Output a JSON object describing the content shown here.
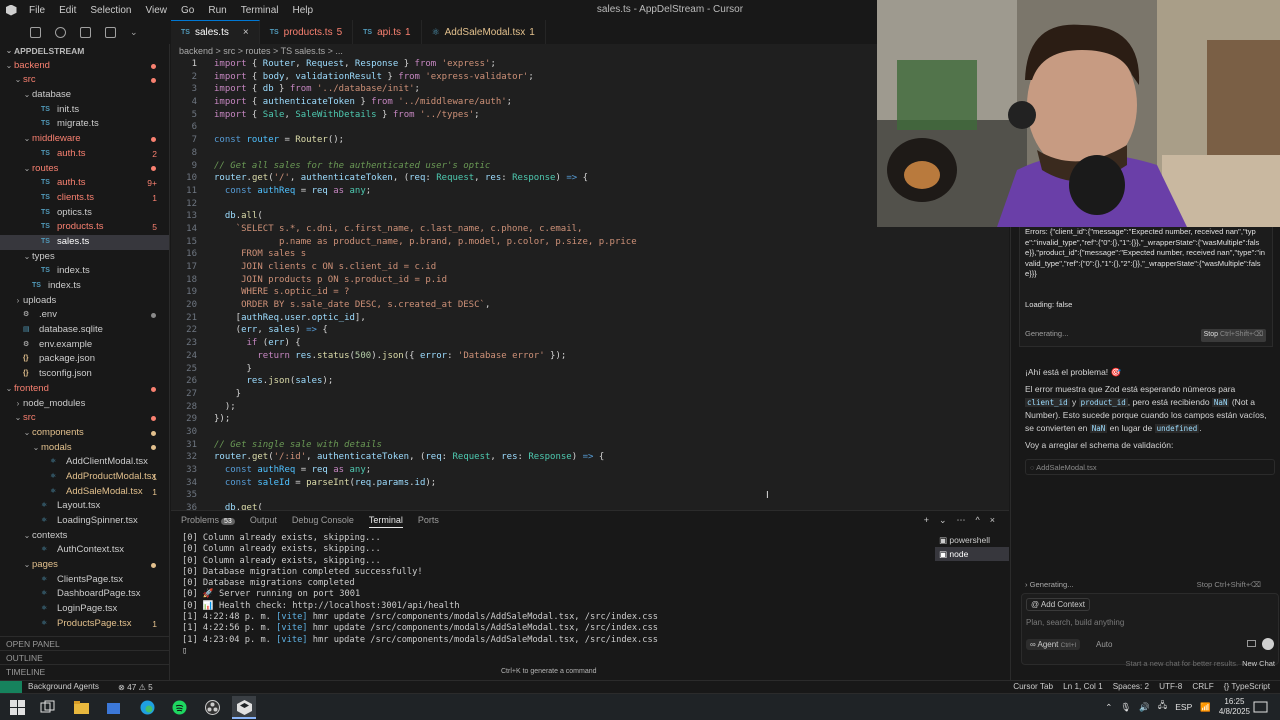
{
  "window": {
    "title": "sales.ts - AppDelStream - Cursor",
    "menu": [
      "File",
      "Edit",
      "Selection",
      "View",
      "Go",
      "Run",
      "Terminal",
      "Help"
    ]
  },
  "explorer": {
    "items": [
      {
        "label": "APPDELSTREAM",
        "depth": 0,
        "kind": "root",
        "color": "#bbbbbb"
      },
      {
        "label": "backend",
        "depth": 0,
        "kind": "folder",
        "color": "#f88070",
        "dot": "#f88070"
      },
      {
        "label": "src",
        "depth": 1,
        "kind": "folder",
        "color": "#f88070",
        "dot": "#f88070"
      },
      {
        "label": "database",
        "depth": 2,
        "kind": "folder",
        "color": "#cccccc"
      },
      {
        "label": "init.ts",
        "depth": 3,
        "kind": "ts",
        "color": "#cccccc"
      },
      {
        "label": "migrate.ts",
        "depth": 3,
        "kind": "ts",
        "color": "#cccccc"
      },
      {
        "label": "middleware",
        "depth": 2,
        "kind": "folder",
        "color": "#f88070",
        "dot": "#f88070"
      },
      {
        "label": "auth.ts",
        "depth": 3,
        "kind": "ts",
        "color": "#f88070",
        "badge": "2"
      },
      {
        "label": "routes",
        "depth": 2,
        "kind": "folder",
        "color": "#f88070",
        "dot": "#f88070"
      },
      {
        "label": "auth.ts",
        "depth": 3,
        "kind": "ts",
        "color": "#f88070",
        "badge": "9+"
      },
      {
        "label": "clients.ts",
        "depth": 3,
        "kind": "ts",
        "color": "#f88070",
        "badge": "1"
      },
      {
        "label": "optics.ts",
        "depth": 3,
        "kind": "ts",
        "color": "#cccccc"
      },
      {
        "label": "products.ts",
        "depth": 3,
        "kind": "ts",
        "color": "#f88070",
        "badge": "5"
      },
      {
        "label": "sales.ts",
        "depth": 3,
        "kind": "ts",
        "color": "#ffffff",
        "active": true
      },
      {
        "label": "types",
        "depth": 2,
        "kind": "folder",
        "color": "#cccccc"
      },
      {
        "label": "index.ts",
        "depth": 3,
        "kind": "ts",
        "color": "#cccccc"
      },
      {
        "label": "index.ts",
        "depth": 2,
        "kind": "ts",
        "color": "#cccccc"
      },
      {
        "label": "uploads",
        "depth": 1,
        "kind": "folder-closed",
        "color": "#cccccc"
      },
      {
        "label": ".env",
        "depth": 1,
        "kind": "env",
        "color": "#cccccc",
        "dot": "#8a8a8a"
      },
      {
        "label": "database.sqlite",
        "depth": 1,
        "kind": "db",
        "color": "#cccccc"
      },
      {
        "label": "env.example",
        "depth": 1,
        "kind": "env",
        "color": "#cccccc"
      },
      {
        "label": "package.json",
        "depth": 1,
        "kind": "json",
        "color": "#cccccc"
      },
      {
        "label": "tsconfig.json",
        "depth": 1,
        "kind": "json",
        "color": "#cccccc"
      },
      {
        "label": "frontend",
        "depth": 0,
        "kind": "folder",
        "color": "#f88070",
        "dot": "#f88070"
      },
      {
        "label": "node_modules",
        "depth": 1,
        "kind": "folder-closed",
        "color": "#cccccc"
      },
      {
        "label": "src",
        "depth": 1,
        "kind": "folder",
        "color": "#f88070",
        "dot": "#f88070"
      },
      {
        "label": "components",
        "depth": 2,
        "kind": "folder",
        "color": "#e2c08d",
        "dot": "#e2c08d"
      },
      {
        "label": "modals",
        "depth": 3,
        "kind": "folder",
        "color": "#e2c08d",
        "dot": "#e2c08d"
      },
      {
        "label": "AddClientModal.tsx",
        "depth": 4,
        "kind": "tsx",
        "color": "#cccccc"
      },
      {
        "label": "AddProductModal.tsx",
        "depth": 4,
        "kind": "tsx",
        "color": "#e2c08d",
        "badge": "1"
      },
      {
        "label": "AddSaleModal.tsx",
        "depth": 4,
        "kind": "tsx",
        "color": "#e2c08d",
        "badge": "1"
      },
      {
        "label": "Layout.tsx",
        "depth": 3,
        "kind": "tsx",
        "color": "#cccccc"
      },
      {
        "label": "LoadingSpinner.tsx",
        "depth": 3,
        "kind": "tsx",
        "color": "#cccccc"
      },
      {
        "label": "contexts",
        "depth": 2,
        "kind": "folder",
        "color": "#cccccc"
      },
      {
        "label": "AuthContext.tsx",
        "depth": 3,
        "kind": "tsx",
        "color": "#cccccc"
      },
      {
        "label": "pages",
        "depth": 2,
        "kind": "folder",
        "color": "#e2c08d",
        "dot": "#e2c08d"
      },
      {
        "label": "ClientsPage.tsx",
        "depth": 3,
        "kind": "tsx",
        "color": "#cccccc"
      },
      {
        "label": "DashboardPage.tsx",
        "depth": 3,
        "kind": "tsx",
        "color": "#cccccc"
      },
      {
        "label": "LoginPage.tsx",
        "depth": 3,
        "kind": "tsx",
        "color": "#cccccc"
      },
      {
        "label": "ProductsPage.tsx",
        "depth": 3,
        "kind": "tsx",
        "color": "#e2c08d",
        "badge": "1"
      }
    ],
    "outline_label": "OUTLINE",
    "timeline_label": "TIMELINE",
    "openpanel_label": "OPEN PANEL"
  },
  "tabs": [
    {
      "label": "sales.ts",
      "icon": "TS",
      "active": true,
      "close": "×",
      "color": "#ffffff"
    },
    {
      "label": "products.ts",
      "icon": "TS",
      "count": "5",
      "color": "#f88070"
    },
    {
      "label": "api.ts",
      "icon": "TS",
      "count": "1",
      "color": "#f88070"
    },
    {
      "label": "AddSaleModal.tsx",
      "icon": "⚛",
      "count": "1",
      "color": "#e2c08d"
    }
  ],
  "breadcrumb": "backend > src > routes > TS sales.ts > ...",
  "code": [
    [
      [
        "kw2",
        "import"
      ],
      [
        "code",
        " { "
      ],
      [
        "var",
        "Router"
      ],
      [
        "code",
        ", "
      ],
      [
        "var",
        "Request"
      ],
      [
        "code",
        ", "
      ],
      [
        "var",
        "Response"
      ],
      [
        "code",
        " } "
      ],
      [
        "kw2",
        "from"
      ],
      [
        "code",
        " "
      ],
      [
        "str",
        "'express'"
      ],
      [
        "code",
        ";"
      ]
    ],
    [
      [
        "kw2",
        "import"
      ],
      [
        "code",
        " { "
      ],
      [
        "var",
        "body"
      ],
      [
        "code",
        ", "
      ],
      [
        "var",
        "validationResult"
      ],
      [
        "code",
        " } "
      ],
      [
        "kw2",
        "from"
      ],
      [
        "code",
        " "
      ],
      [
        "str",
        "'express-validator'"
      ],
      [
        "code",
        ";"
      ]
    ],
    [
      [
        "kw2",
        "import"
      ],
      [
        "code",
        " { "
      ],
      [
        "var",
        "db"
      ],
      [
        "code",
        " } "
      ],
      [
        "kw2",
        "from"
      ],
      [
        "code",
        " "
      ],
      [
        "str",
        "'../database/init'"
      ],
      [
        "code",
        ";"
      ]
    ],
    [
      [
        "kw2",
        "import"
      ],
      [
        "code",
        " { "
      ],
      [
        "var",
        "authenticateToken"
      ],
      [
        "code",
        " } "
      ],
      [
        "kw2",
        "from"
      ],
      [
        "code",
        " "
      ],
      [
        "str",
        "'../middleware/auth'"
      ],
      [
        "code",
        ";"
      ]
    ],
    [
      [
        "kw2",
        "import"
      ],
      [
        "code",
        " { "
      ],
      [
        "ty",
        "Sale"
      ],
      [
        "code",
        ", "
      ],
      [
        "ty",
        "SaleWithDetails"
      ],
      [
        "code",
        " } "
      ],
      [
        "kw2",
        "from"
      ],
      [
        "code",
        " "
      ],
      [
        "str",
        "'../types'"
      ],
      [
        "code",
        ";"
      ]
    ],
    [],
    [
      [
        "kw",
        "const"
      ],
      [
        "code",
        " "
      ],
      [
        "cst",
        "router"
      ],
      [
        "code",
        " = "
      ],
      [
        "fn",
        "Router"
      ],
      [
        "code",
        "();"
      ]
    ],
    [],
    [
      [
        "cm",
        "// Get all sales for the authenticated user's optic"
      ]
    ],
    [
      [
        "var",
        "router"
      ],
      [
        "code",
        "."
      ],
      [
        "fn",
        "get"
      ],
      [
        "code",
        "("
      ],
      [
        "str",
        "'/'"
      ],
      [
        "code",
        ", "
      ],
      [
        "var",
        "authenticateToken"
      ],
      [
        "code",
        ", ("
      ],
      [
        "var",
        "req"
      ],
      [
        "code",
        ": "
      ],
      [
        "ty",
        "Request"
      ],
      [
        "code",
        ", "
      ],
      [
        "var",
        "res"
      ],
      [
        "code",
        ": "
      ],
      [
        "ty",
        "Response"
      ],
      [
        "code",
        ") "
      ],
      [
        "kw",
        "=>"
      ],
      [
        "code",
        " {"
      ]
    ],
    [
      [
        "code",
        "  "
      ],
      [
        "kw",
        "const"
      ],
      [
        "code",
        " "
      ],
      [
        "cst",
        "authReq"
      ],
      [
        "code",
        " = "
      ],
      [
        "var",
        "req"
      ],
      [
        "code",
        " "
      ],
      [
        "kw2",
        "as"
      ],
      [
        "code",
        " "
      ],
      [
        "ty",
        "any"
      ],
      [
        "code",
        ";"
      ]
    ],
    [],
    [
      [
        "code",
        "  "
      ],
      [
        "var",
        "db"
      ],
      [
        "code",
        "."
      ],
      [
        "fn",
        "all"
      ],
      [
        "code",
        "("
      ]
    ],
    [
      [
        "code",
        "    "
      ],
      [
        "str",
        "`SELECT s.*, c.dni, c.first_name, c.last_name, c.phone, c.email,"
      ]
    ],
    [
      [
        "str",
        "            p.name as product_name, p.brand, p.model, p.color, p.size, p.price"
      ]
    ],
    [
      [
        "str",
        "     FROM sales s"
      ]
    ],
    [
      [
        "str",
        "     JOIN clients c ON s.client_id = c.id"
      ]
    ],
    [
      [
        "str",
        "     JOIN products p ON s.product_id = p.id"
      ]
    ],
    [
      [
        "str",
        "     WHERE s.optic_id = ?"
      ]
    ],
    [
      [
        "str",
        "     ORDER BY s.sale_date DESC, s.created_at DESC`"
      ],
      [
        "code",
        ","
      ]
    ],
    [
      [
        "code",
        "    ["
      ],
      [
        "var",
        "authReq"
      ],
      [
        "code",
        "."
      ],
      [
        "var",
        "user"
      ],
      [
        "code",
        "."
      ],
      [
        "var",
        "optic_id"
      ],
      [
        "code",
        "],"
      ]
    ],
    [
      [
        "code",
        "    ("
      ],
      [
        "var",
        "err"
      ],
      [
        "code",
        ", "
      ],
      [
        "var",
        "sales"
      ],
      [
        "code",
        ") "
      ],
      [
        "kw",
        "=>"
      ],
      [
        "code",
        " {"
      ]
    ],
    [
      [
        "code",
        "      "
      ],
      [
        "kw2",
        "if"
      ],
      [
        "code",
        " ("
      ],
      [
        "var",
        "err"
      ],
      [
        "code",
        ") {"
      ]
    ],
    [
      [
        "code",
        "        "
      ],
      [
        "kw2",
        "return"
      ],
      [
        "code",
        " "
      ],
      [
        "var",
        "res"
      ],
      [
        "code",
        "."
      ],
      [
        "fn",
        "status"
      ],
      [
        "code",
        "("
      ],
      [
        "num",
        "500"
      ],
      [
        "code",
        ")."
      ],
      [
        "fn",
        "json"
      ],
      [
        "code",
        "({ "
      ],
      [
        "var",
        "error"
      ],
      [
        "code",
        ": "
      ],
      [
        "str",
        "'Database error'"
      ],
      [
        "code",
        " });"
      ]
    ],
    [
      [
        "code",
        "      }"
      ]
    ],
    [
      [
        "code",
        "      "
      ],
      [
        "var",
        "res"
      ],
      [
        "code",
        "."
      ],
      [
        "fn",
        "json"
      ],
      [
        "code",
        "("
      ],
      [
        "var",
        "sales"
      ],
      [
        "code",
        ");"
      ]
    ],
    [
      [
        "code",
        "    }"
      ]
    ],
    [
      [
        "code",
        "  );"
      ]
    ],
    [
      [
        "code",
        "});"
      ]
    ],
    [],
    [
      [
        "cm",
        "// Get single sale with details"
      ]
    ],
    [
      [
        "var",
        "router"
      ],
      [
        "code",
        "."
      ],
      [
        "fn",
        "get"
      ],
      [
        "code",
        "("
      ],
      [
        "str",
        "'/:id'"
      ],
      [
        "code",
        ", "
      ],
      [
        "var",
        "authenticateToken"
      ],
      [
        "code",
        ", ("
      ],
      [
        "var",
        "req"
      ],
      [
        "code",
        ": "
      ],
      [
        "ty",
        "Request"
      ],
      [
        "code",
        ", "
      ],
      [
        "var",
        "res"
      ],
      [
        "code",
        ": "
      ],
      [
        "ty",
        "Response"
      ],
      [
        "code",
        ") "
      ],
      [
        "kw",
        "=>"
      ],
      [
        "code",
        " {"
      ]
    ],
    [
      [
        "code",
        "  "
      ],
      [
        "kw",
        "const"
      ],
      [
        "code",
        " "
      ],
      [
        "cst",
        "authReq"
      ],
      [
        "code",
        " = "
      ],
      [
        "var",
        "req"
      ],
      [
        "code",
        " "
      ],
      [
        "kw2",
        "as"
      ],
      [
        "code",
        " "
      ],
      [
        "ty",
        "any"
      ],
      [
        "code",
        ";"
      ]
    ],
    [
      [
        "code",
        "  "
      ],
      [
        "kw",
        "const"
      ],
      [
        "code",
        " "
      ],
      [
        "cst",
        "saleId"
      ],
      [
        "code",
        " = "
      ],
      [
        "fn",
        "parseInt"
      ],
      [
        "code",
        "("
      ],
      [
        "var",
        "req"
      ],
      [
        "code",
        "."
      ],
      [
        "var",
        "params"
      ],
      [
        "code",
        "."
      ],
      [
        "var",
        "id"
      ],
      [
        "code",
        ");"
      ]
    ],
    [],
    [
      [
        "code",
        "  "
      ],
      [
        "var",
        "db"
      ],
      [
        "code",
        "."
      ],
      [
        "fn",
        "get"
      ],
      [
        "code",
        "("
      ]
    ]
  ],
  "panel": {
    "tabs": [
      {
        "label": "Problems",
        "badge": "53"
      },
      {
        "label": "Output"
      },
      {
        "label": "Debug Console"
      },
      {
        "label": "Terminal",
        "active": true
      },
      {
        "label": "Ports"
      }
    ],
    "controls": [
      "+",
      "⌄",
      "⋯",
      "^",
      "×"
    ],
    "terminal_lines": [
      "[0] Column already exists, skipping...",
      "[0] Column already exists, skipping...",
      "[0] Column already exists, skipping...",
      "[0] Database migration completed successfully!",
      "[0] Database migrations completed",
      "[0] 🚀 Server running on port 3001",
      "[0] 📊 Health check: http://localhost:3001/api/health",
      "[1] 4:22:48 p. m. [vite] hmr update /src/components/modals/AddSaleModal.tsx, /src/index.css",
      "[1] 4:22:56 p. m. [vite] hmr update /src/components/modals/AddSaleModal.tsx, /src/index.css",
      "[1] 4:23:04 p. m. [vite] hmr update /src/components/modals/AddSaleModal.tsx, /src/index.css"
    ],
    "terminals": [
      "powershell",
      "node"
    ],
    "hint": "Ctrl+K to generate a command"
  },
  "chat": {
    "error_text": "Errors: {\"client_id\":{\"message\":\"Expected number, received nan\",\"type\":\"invalid_type\",\"ref\":{\"0\":{},\"1\":{}},\"_wrapperState\":{\"wasMultiple\":false}},\"product_id\":{\"message\":\"Expected number, received nan\",\"type\":\"invalid_type\",\"ref\":{\"0\":{},\"1\":{},\"2\":{}},\"_wrapperState\":{\"wasMultiple\":false}}}",
    "loading": "Loading: false",
    "generating": "Generating...",
    "stop": "Stop",
    "stop_shortcut": "Ctrl+Shift+⌫",
    "headline": "¡Ahí está el problema! 🎯",
    "p1_a": "El error muestra que Zod está esperando números para",
    "p1_code1": "client_id",
    "p1_b": "y",
    "p1_code2": "product_id",
    "p1_c": ", pero está recibiendo",
    "p1_code3": "NaN",
    "p1_d": "(Not a Number). Esto sucede porque cuando los campos están vacíos, se convierten en",
    "p1_code4": "NaN",
    "p1_e": "en lugar de",
    "p1_code5": "undefined",
    "p1_f": ".",
    "p2": "Voy a arreglar el schema de validación:",
    "file_chip": "AddSaleModal.tsx",
    "generating2": "Generating...",
    "stop2": "Stop Ctrl+Shift+⌫",
    "add_context": "Add Context",
    "placeholder": "Plan, search, build anything",
    "agent": "Agent",
    "agent_shortcut": "Ctrl+I",
    "auto": "Auto",
    "newchat_hint": "Start a new chat for better results.",
    "newchat": "New Chat"
  },
  "status": {
    "agents": "Background Agents",
    "problems": "⊗ 47 ⚠ 5",
    "right": [
      "Cursor Tab",
      "Ln 1, Col 1",
      "Spaces: 2",
      "UTF-8",
      "CRLF",
      "{} TypeScript"
    ]
  },
  "taskbar": {
    "lang": "ESP",
    "time": "16:25",
    "date": "4/8/2025"
  }
}
